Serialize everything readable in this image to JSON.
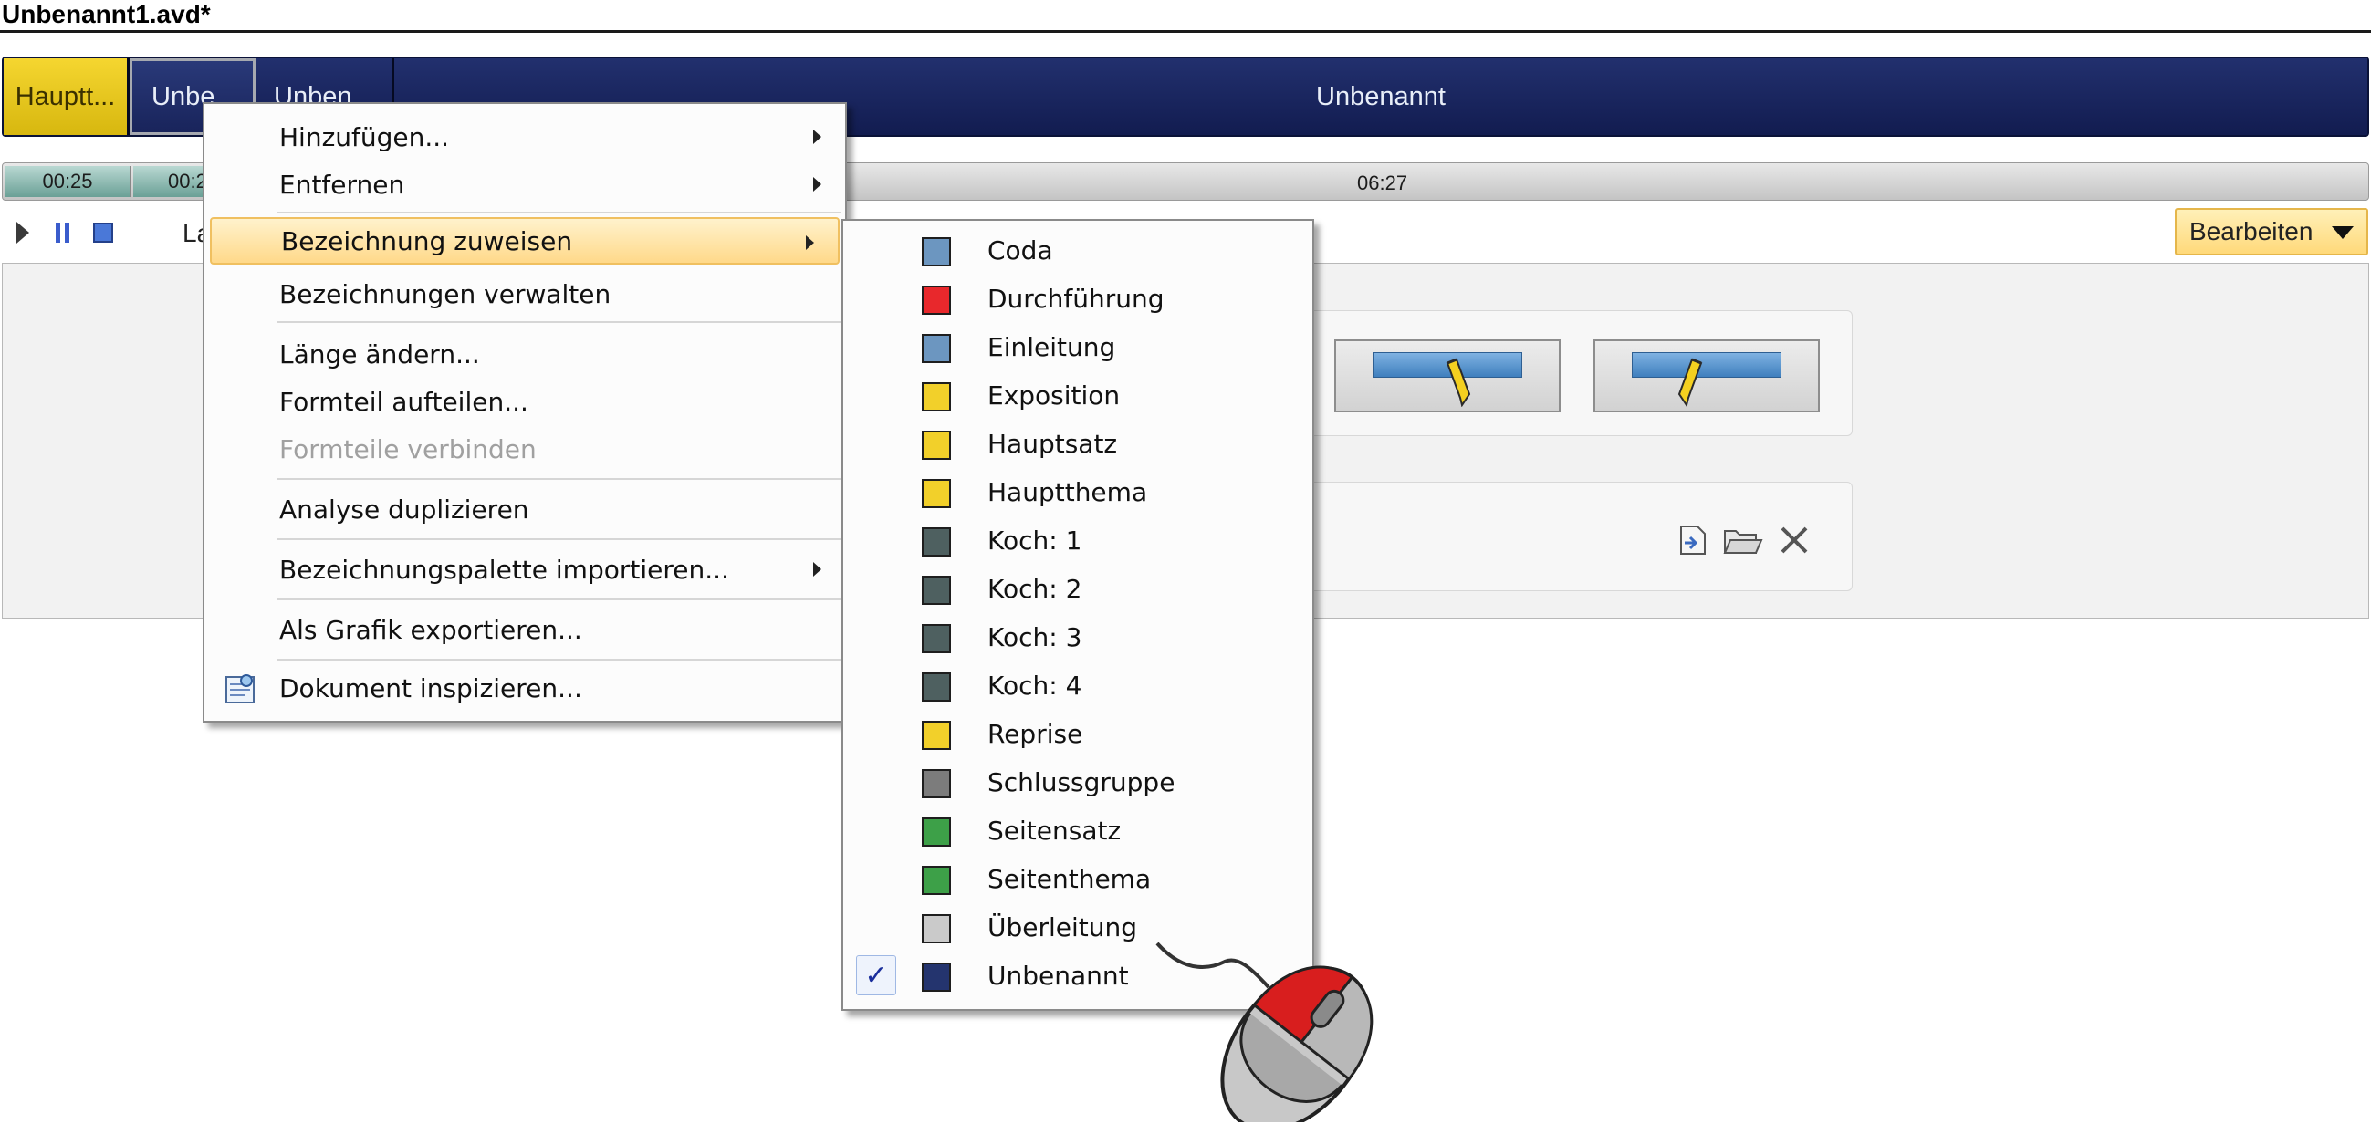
{
  "window": {
    "title": "Unbenannt1.avd*"
  },
  "form_parts": [
    {
      "label": "Hauptt...",
      "color": "#E6C618"
    },
    {
      "label": "Unbe",
      "color": "#1C2A66"
    },
    {
      "label": "Unben",
      "color": "#1C2A66"
    },
    {
      "label": "Unbenannt",
      "color": "#1C2A66"
    }
  ],
  "timeline": {
    "seg1": "00:25",
    "seg2": "00:2",
    "total": "06:27"
  },
  "player": {
    "play_icon": "play-icon",
    "pause_icon": "pause-icon",
    "stop_icon": "stop-icon",
    "label_fragment": "La"
  },
  "edit_button": {
    "label": "Bearbeiten"
  },
  "context_menu": {
    "items": {
      "add": "Hinzufügen...",
      "remove": "Entfernen",
      "assign": "Bezeichnung zuweisen",
      "manage": "Bezeichnungen verwalten",
      "length": "Länge ändern...",
      "split": "Formteil aufteilen...",
      "join": "Formteile verbinden",
      "duplicate": "Analyse duplizieren",
      "palette": "Bezeichnungspalette importieren...",
      "export": "Als Grafik exportieren...",
      "inspect": "Dokument inspizieren..."
    }
  },
  "label_submenu": [
    {
      "label": "Coda",
      "color": "#6C96C0",
      "checked": false
    },
    {
      "label": "Durchführung",
      "color": "#E8282C",
      "checked": false
    },
    {
      "label": "Einleitung",
      "color": "#6C96C0",
      "checked": false
    },
    {
      "label": "Exposition",
      "color": "#F2D02A",
      "checked": false
    },
    {
      "label": "Hauptsatz",
      "color": "#F2D02A",
      "checked": false
    },
    {
      "label": "Hauptthema",
      "color": "#F2D02A",
      "checked": false
    },
    {
      "label": "Koch: 1",
      "color": "#4E6060",
      "checked": false
    },
    {
      "label": "Koch: 2",
      "color": "#4E6060",
      "checked": false
    },
    {
      "label": "Koch: 3",
      "color": "#4E6060",
      "checked": false
    },
    {
      "label": "Koch: 4",
      "color": "#4E6060",
      "checked": false
    },
    {
      "label": "Reprise",
      "color": "#F2D02A",
      "checked": false
    },
    {
      "label": "Schlussgruppe",
      "color": "#7C7C7C",
      "checked": false
    },
    {
      "label": "Seitensatz",
      "color": "#3DA048",
      "checked": false
    },
    {
      "label": "Seitenthema",
      "color": "#3DA048",
      "checked": false
    },
    {
      "label": "Überleitung",
      "color": "#CACACA",
      "checked": false
    },
    {
      "label": "Unbenannt",
      "color": "#24346E",
      "checked": true
    }
  ]
}
